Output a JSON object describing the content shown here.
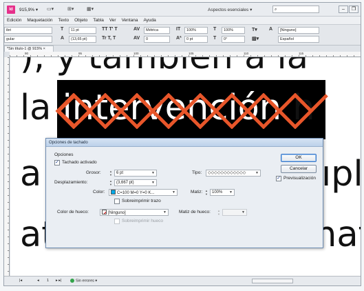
{
  "titlebar": {
    "logo": "Id",
    "zoom": "915,9%",
    "workspace": "Aspectos esenciales",
    "search_placeholder": ""
  },
  "menu": [
    "Edición",
    "Maquetación",
    "Texto",
    "Objeto",
    "Tabla",
    "Ver",
    "Ventana",
    "Ayuda"
  ],
  "control_panel": {
    "font_family": "ibri",
    "font_style": "gular",
    "font_size": "11 pt",
    "leading": "(13,65 pt)",
    "kerning": "Métrica",
    "tracking": "0",
    "vscale": "100%",
    "hscale": "100%",
    "baseline": "0 pt",
    "skew": "0°",
    "char_style": "[Ninguno]",
    "language": "Español"
  },
  "doc_tab": "*Sin título-1 @ 915% ×",
  "ruler_labels": [
    "90",
    "95",
    "100",
    "105",
    "110",
    "115"
  ],
  "document": {
    "line1": "), y también a la",
    "line2_before": "la ",
    "line2_highlight": "intervención",
    "line2_after": " h",
    "line3": "a el",
    "line3_end": "ıpl",
    "line4": "atur",
    "line4_end": "nat",
    "line5": ""
  },
  "dialog": {
    "title": "Opciones de tachado",
    "group_label": "Opciones",
    "strike_enabled_label": "Tachado activado",
    "strike_enabled": true,
    "grosor_label": "Grosor:",
    "grosor_value": "6 pt",
    "tipo_label": "Tipo:",
    "tipo_value": "◇◇◇◇◇◇◇◇◇◇◇◇",
    "desplazamiento_label": "Desplazamiento:",
    "desplazamiento_value": "(3,667 pt)",
    "color_label": "Color:",
    "color_value": "C=100 M=0 Y=0 K...",
    "matiz_label": "Matiz:",
    "matiz_value": "100%",
    "sobreimprimir_trazo_label": "Sobreimprimir trazo",
    "color_hueco_label": "Color de hueco:",
    "color_hueco_value": "[Ninguno]",
    "matiz_hueco_label": "Matiz de hueco:",
    "matiz_hueco_value": "",
    "sobreimprimir_hueco_label": "Sobreimprimir hueco",
    "ok_label": "OK",
    "cancel_label": "Cancelar",
    "preview_label": "Previsualización",
    "preview_checked": true
  },
  "status": {
    "page": "1",
    "preflight": "Sin errores"
  },
  "colors": {
    "stroke": "#e8562a",
    "swatch_cyan": "#00a9e8"
  }
}
